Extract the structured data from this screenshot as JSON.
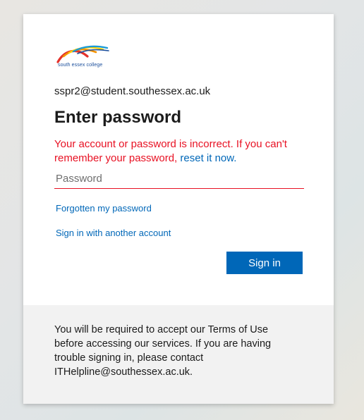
{
  "logo": {
    "text": "south essex college",
    "colors": [
      "#e4322b",
      "#f39200",
      "#fcd000",
      "#1b9ad6",
      "#1b4f9c"
    ]
  },
  "identity": "sspr2@student.southessex.ac.uk",
  "title": "Enter password",
  "error": {
    "text": "Your account or password is incorrect. If you can't remember your password, ",
    "link": "reset it now.",
    "color": "#e81123"
  },
  "password": {
    "placeholder": "Password",
    "value": ""
  },
  "links": {
    "forgot": "Forgotten my password",
    "another_account": "Sign in with another account"
  },
  "signin_button": "Sign in",
  "footer": "You will be required to accept our Terms of Use before accessing our services. If you are having trouble signing in, please contact ITHelpline@southessex.ac.uk.",
  "accent_color": "#0067b8"
}
